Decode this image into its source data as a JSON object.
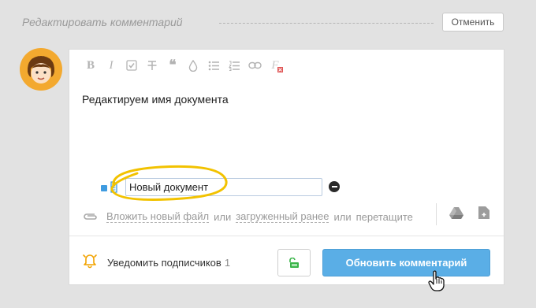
{
  "header": {
    "title": "Редактировать комментарий",
    "cancel_label": "Отменить"
  },
  "toolbar": {
    "buttons": [
      "bold-icon",
      "italic-icon",
      "checkbox-icon",
      "strikethrough-icon",
      "quote-icon",
      "color-drop-icon",
      "bullet-list-icon",
      "numbered-list-icon",
      "link-icon",
      "clear-format-icon"
    ],
    "bold_glyph": "B",
    "italic_glyph": "I",
    "quote_glyph": "❝",
    "clear_glyph": "F"
  },
  "editor": {
    "body_text": "Редактируем имя документа"
  },
  "attachment": {
    "name_value": "Новый документ",
    "accent_color": "#3f9be0",
    "highlight_color": "#f2c200"
  },
  "upload": {
    "attach_new": "Вложить новый файл",
    "or1": "или",
    "uploaded_before": "загруженный ранее",
    "or2": "или",
    "drag": "перетащите"
  },
  "footer": {
    "notify_label": "Уведомить подписчиков",
    "notify_count": "1",
    "update_label": "Обновить комментарий",
    "button_color": "#5aaee6",
    "lock_color": "#3bb54a",
    "bell_color": "#f2a300"
  }
}
